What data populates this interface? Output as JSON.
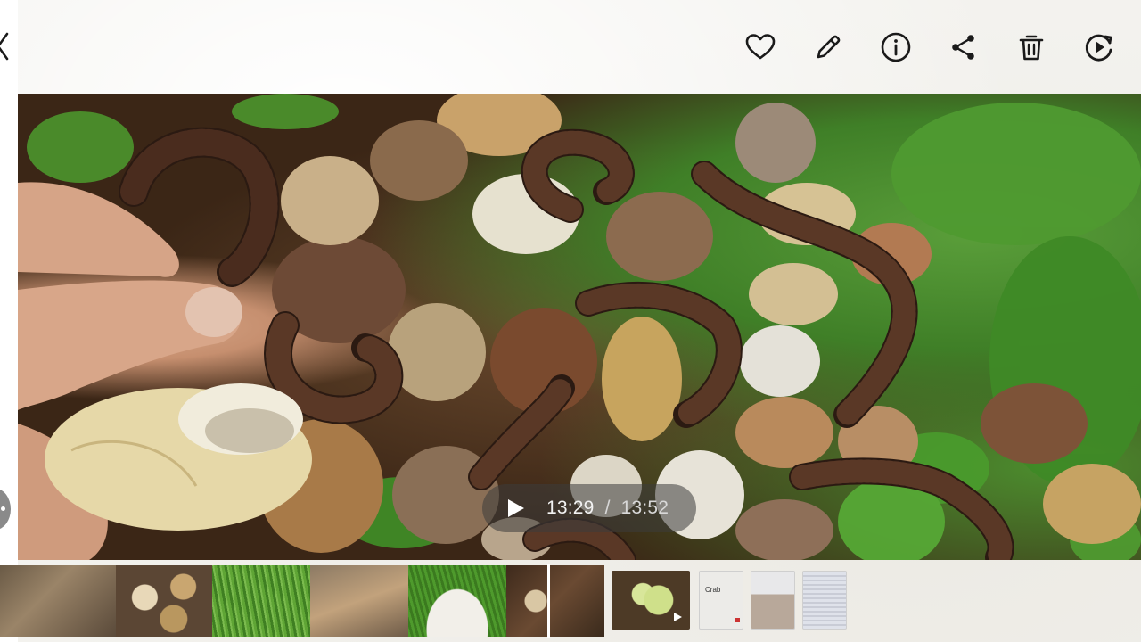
{
  "viewer": {
    "toolbar": {
      "favorite_icon": "heart-icon",
      "edit_icon": "pencil-icon",
      "info_icon": "info-icon",
      "share_icon": "share-icon",
      "delete_icon": "trash-icon",
      "remaster_icon": "rotate-play-icon"
    },
    "back_icon": "chevron-left-icon"
  },
  "video": {
    "current_time": "13:29",
    "separator": "/",
    "total_time": "13:52",
    "progress_fraction": 0.972
  },
  "filmstrip": {
    "thumbnails": [
      {
        "label": ""
      },
      {
        "label": "Crab"
      },
      {
        "label": ""
      },
      {
        "label": ""
      }
    ]
  },
  "colors": {
    "toolbar_icon": "#1a1a1a",
    "pill_bg": "#3c3c3c",
    "background": "#f3f2ee"
  }
}
